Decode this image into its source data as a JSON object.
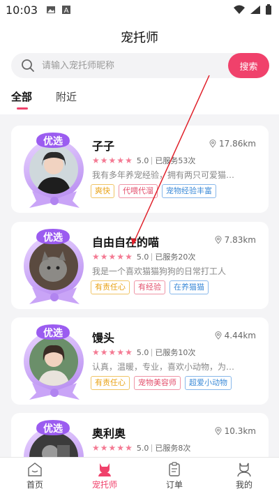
{
  "status_bar": {
    "time": "10:03"
  },
  "header": {
    "title": "宠托师",
    "search": {
      "placeholder": "请输入宠托师昵称",
      "value": "",
      "button_label": "搜索"
    },
    "tabs": [
      {
        "label": "全部",
        "active": true
      },
      {
        "label": "附近",
        "active": false
      }
    ]
  },
  "sitters": [
    {
      "badge": "优选",
      "name": "子子",
      "distance": "17.86km",
      "rating": "5.0",
      "served": "已服务53次",
      "description": "我有多年养宠经验，拥有两只可爱猫…",
      "tags": [
        "爽快",
        "代喂代溜",
        "宠物经验丰富"
      ]
    },
    {
      "badge": "优选",
      "name": "自由自在的喵",
      "distance": "7.83km",
      "rating": "5.0",
      "served": "已服务20次",
      "description": "我是一个喜欢猫猫狗狗的日常打工人",
      "tags": [
        "有责任心",
        "有经验",
        "在养猫猫"
      ]
    },
    {
      "badge": "优选",
      "name": "馒头",
      "distance": "4.44km",
      "rating": "5.0",
      "served": "已服务10次",
      "description": "认真，温暖，专业，喜欢小动物，为…",
      "tags": [
        "有责任心",
        "宠物美容师",
        "超爱小动物"
      ]
    },
    {
      "badge": "优选",
      "name": "奥利奥",
      "distance": "10.3km",
      "rating": "5.0",
      "served": "已服务8次",
      "description": "",
      "tags": []
    }
  ],
  "bottom_nav": [
    {
      "label": "首页",
      "icon": "home-icon",
      "active": false
    },
    {
      "label": "宠托师",
      "icon": "sitter-icon",
      "active": true
    },
    {
      "label": "订单",
      "icon": "order-icon",
      "active": false
    },
    {
      "label": "我的",
      "icon": "profile-icon",
      "active": false
    }
  ],
  "colors": {
    "accent": "#f0416b",
    "star": "#f47a93",
    "tag_yellow": "#e9a317",
    "tag_red": "#e3506d",
    "tag_blue": "#3d8bd8"
  }
}
